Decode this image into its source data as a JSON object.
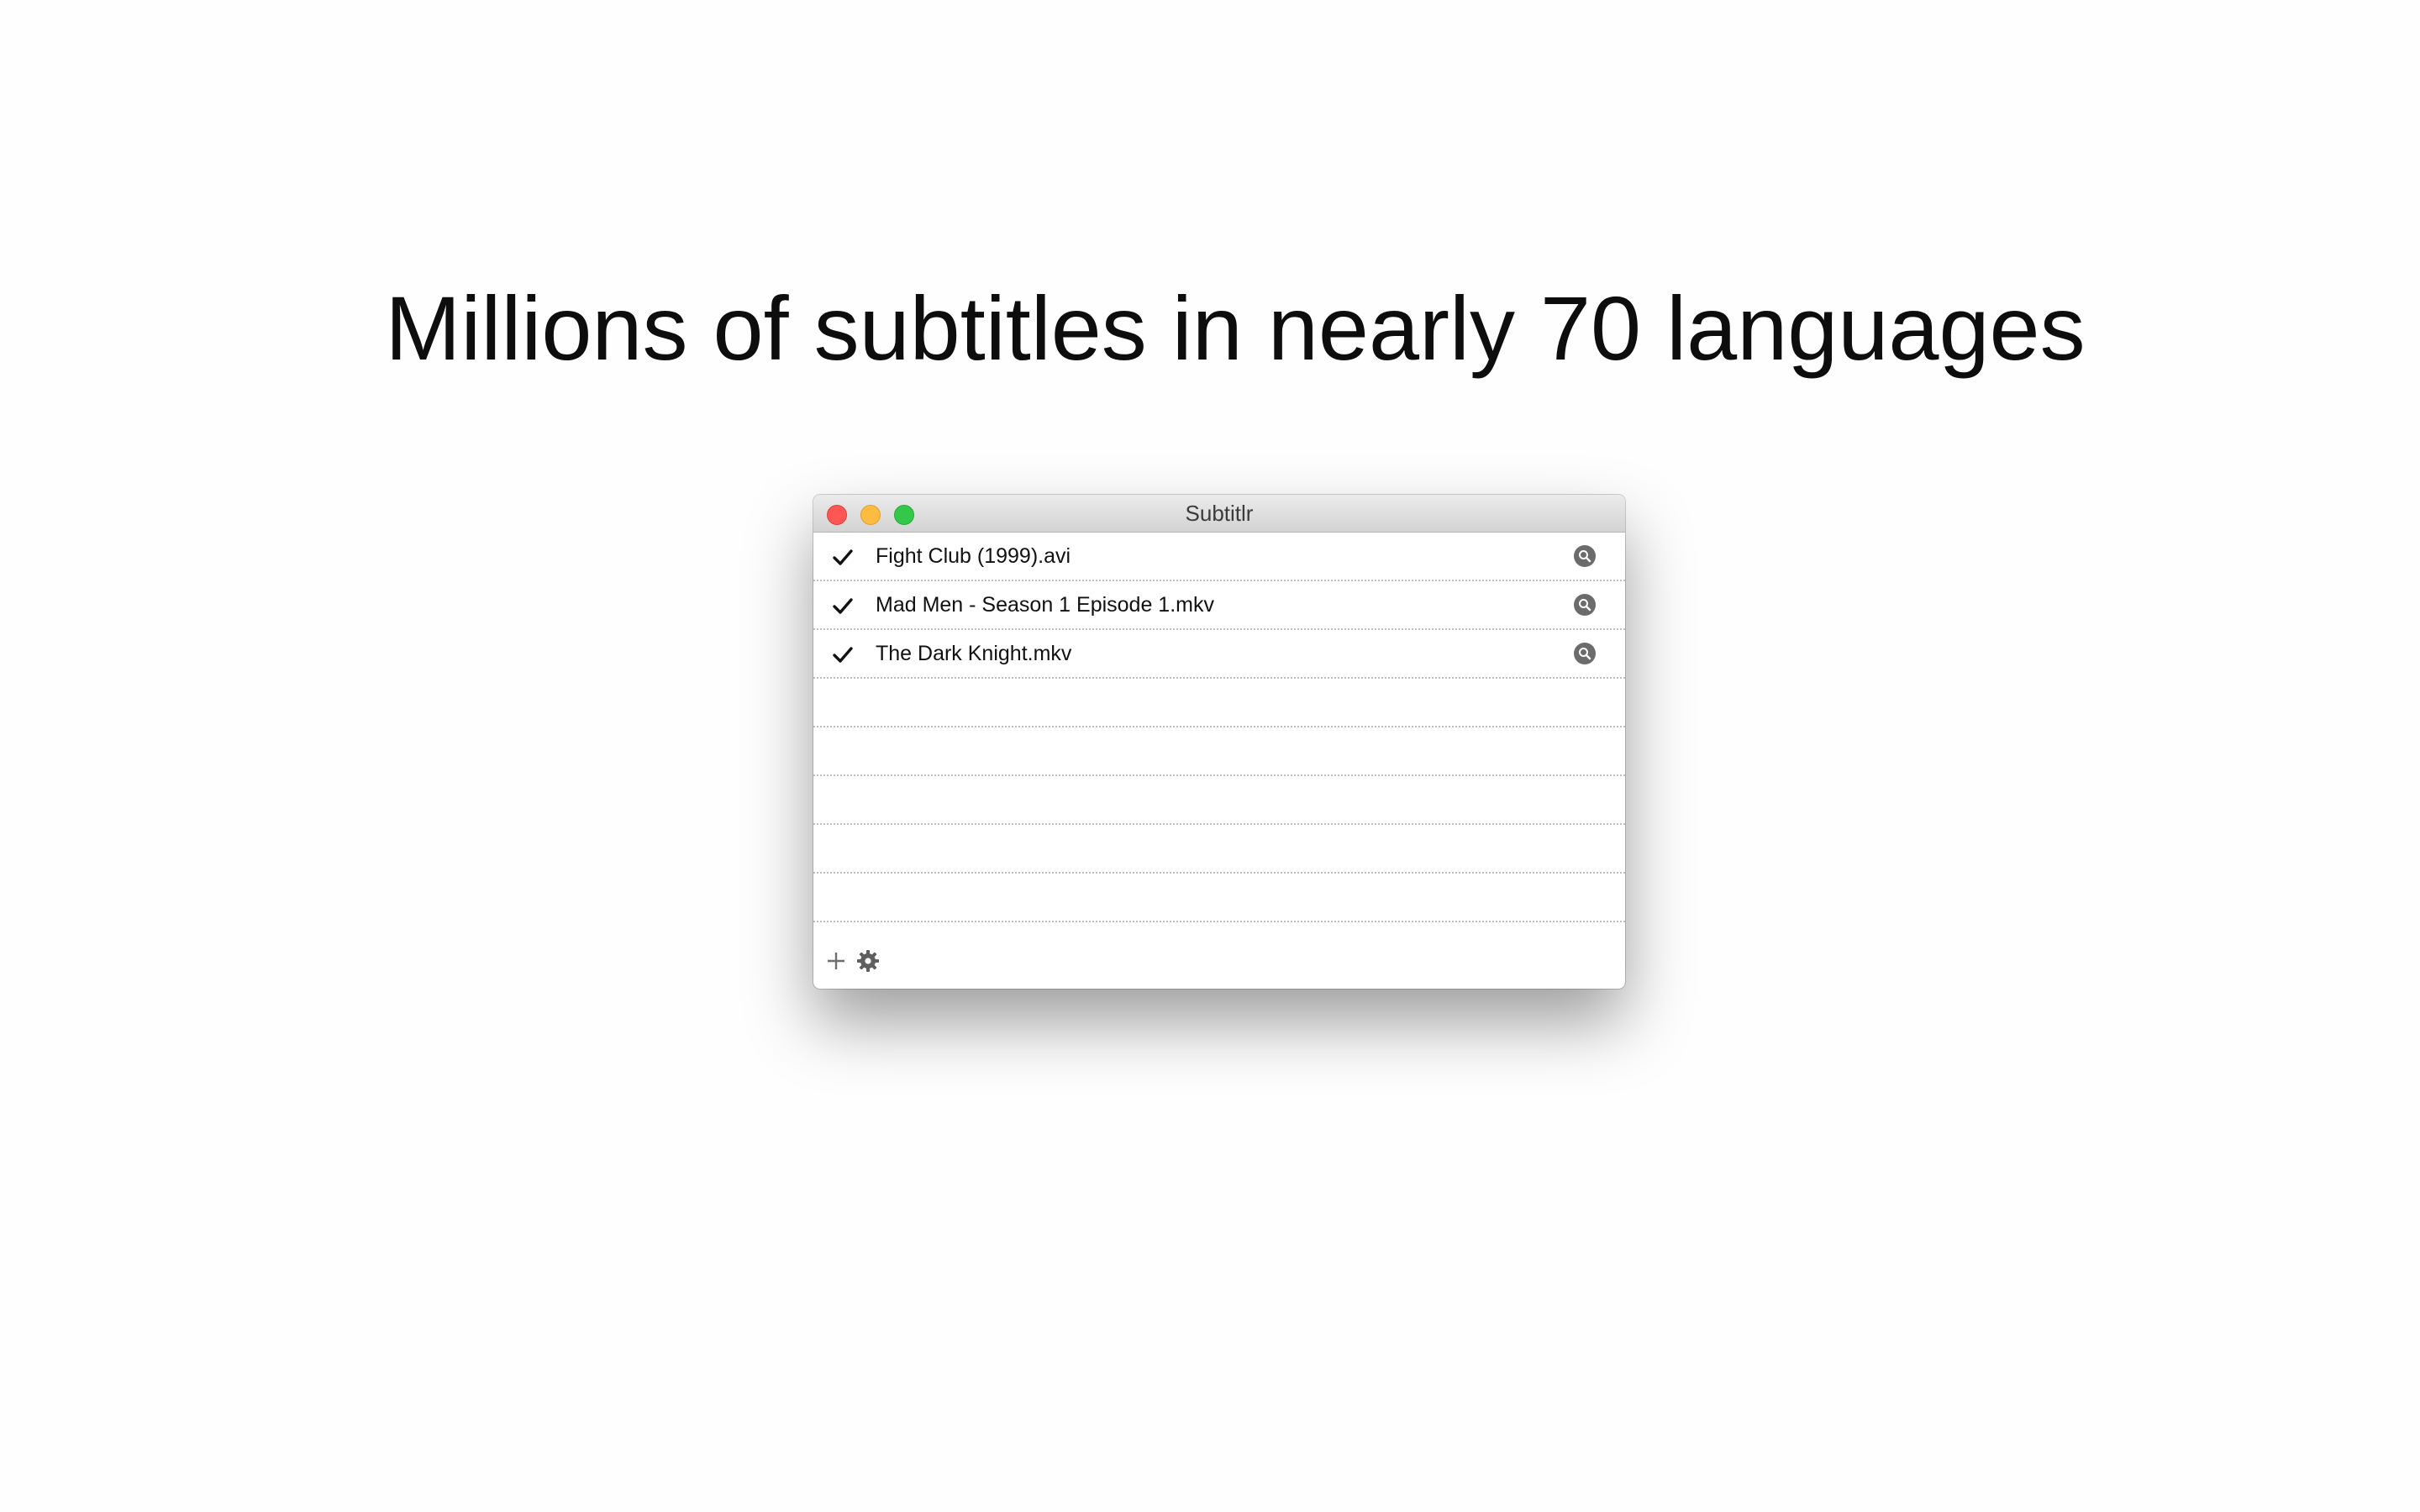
{
  "headline": "Millions of subtitles in nearly 70 languages",
  "window": {
    "title": "Subtitlr",
    "controls": {
      "close_color": "#fc5753",
      "minimize_color": "#fdbc40",
      "maximize_color": "#34c84a"
    },
    "files": [
      {
        "name": "Fight Club (1999).avi",
        "checked": true
      },
      {
        "name": "Mad Men - Season 1 Episode 1.mkv",
        "checked": true
      },
      {
        "name": "The Dark Knight.mkv",
        "checked": true
      }
    ],
    "footer": {
      "add_icon": "plus-icon",
      "settings_icon": "gear-icon"
    }
  }
}
